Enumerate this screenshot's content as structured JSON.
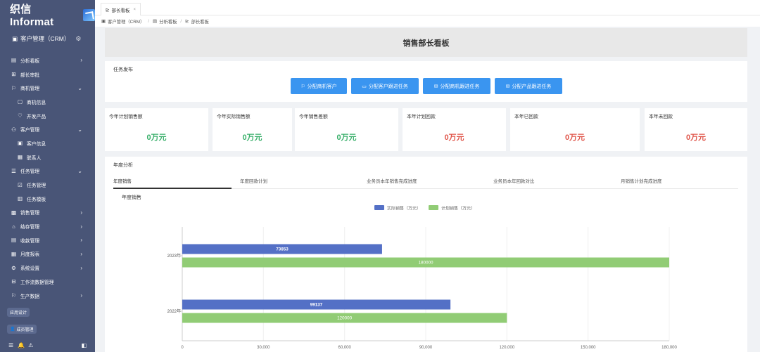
{
  "app": {
    "logo": "织信 Informat",
    "module": "客户管理（CRM）"
  },
  "sidebar": {
    "items": [
      {
        "label": "分析看板",
        "icon": "dashboard-icon",
        "arrow": "›",
        "sub": false
      },
      {
        "label": "部长审批",
        "icon": "grid-icon",
        "arrow": "",
        "sub": false
      },
      {
        "label": "商机管理",
        "icon": "flag-icon",
        "arrow": "⌄",
        "sub": false
      },
      {
        "label": "商机信息",
        "icon": "chat-icon",
        "arrow": "",
        "sub": true
      },
      {
        "label": "开发产品",
        "icon": "heart-icon",
        "arrow": "",
        "sub": true
      },
      {
        "label": "客户管理",
        "icon": "users-icon",
        "arrow": "⌄",
        "sub": false
      },
      {
        "label": "客户信息",
        "icon": "card-icon",
        "arrow": "",
        "sub": true
      },
      {
        "label": "联系人",
        "icon": "contact-icon",
        "arrow": "",
        "sub": true
      },
      {
        "label": "任务管理",
        "icon": "list-icon",
        "arrow": "⌄",
        "sub": false
      },
      {
        "label": "任务管理",
        "icon": "check-icon",
        "arrow": "",
        "sub": true
      },
      {
        "label": "任务模板",
        "icon": "template-icon",
        "arrow": "",
        "sub": true
      },
      {
        "label": "销售管理",
        "icon": "sales-icon",
        "arrow": "›",
        "sub": false
      },
      {
        "label": "结存管理",
        "icon": "bank-icon",
        "arrow": "›",
        "sub": false
      },
      {
        "label": "收款管理",
        "icon": "receipt-icon",
        "arrow": "›",
        "sub": false
      },
      {
        "label": "月度报表",
        "icon": "report-icon",
        "arrow": "›",
        "sub": false
      },
      {
        "label": "系统设置",
        "icon": "settings-icon",
        "arrow": "›",
        "sub": false
      },
      {
        "label": "工作流数据管理",
        "icon": "workflow-icon",
        "arrow": "",
        "sub": false
      },
      {
        "label": "生产数据",
        "icon": "flag-icon",
        "arrow": "›",
        "sub": false
      }
    ],
    "app_design_label": "应用设计",
    "member_label": "成员管理"
  },
  "tabs": [
    {
      "label": "部长看板",
      "close": "×"
    }
  ],
  "breadcrumb": [
    "客户管理（CRM）",
    "分析看板",
    "部长看板"
  ],
  "page": {
    "title": "销售部长看板"
  },
  "task_section": {
    "title": "任务发布",
    "buttons": [
      "分配商机客户",
      "分配客户跟进任务",
      "分配商机跟进任务",
      "分配产品跟进任务"
    ]
  },
  "stats": [
    {
      "label": "今年计划销售额",
      "value": "0万元",
      "color": "#3ab06b"
    },
    {
      "label": "今年实际销售额",
      "value": "0万元",
      "color": "#3ab06b"
    },
    {
      "label": "今年销售差额",
      "value": "0万元",
      "color": "#3ab06b"
    },
    {
      "label": "本年计划回款",
      "value": "0万元",
      "color": "#e0554a"
    },
    {
      "label": "本年已回款",
      "value": "0万元",
      "color": "#e0554a"
    },
    {
      "label": "本年未回款",
      "value": "0万元",
      "color": "#e0554a"
    }
  ],
  "analysis": {
    "title": "年度分析",
    "tabs": [
      "年度销售",
      "年度回款计划",
      "业务员本年销售完成进度",
      "业务员本年回款对比",
      "月销售计划完成进度"
    ],
    "active_tab": 0
  },
  "chart_data": {
    "type": "bar",
    "orientation": "horizontal",
    "title": "年度销售",
    "categories": [
      "2023年",
      "2022年"
    ],
    "series": [
      {
        "name": "实际销售（万元）",
        "color": "#5470c6",
        "values": [
          73853,
          99137
        ]
      },
      {
        "name": "计划销售（万元）",
        "color": "#91cc75",
        "values": [
          180000,
          120000
        ]
      }
    ],
    "xlim": [
      0,
      180000
    ],
    "xticks": [
      "0",
      "30,000",
      "60,000",
      "90,000",
      "120,000",
      "150,000",
      "180,000"
    ],
    "legend": "top-center",
    "grid": true
  }
}
